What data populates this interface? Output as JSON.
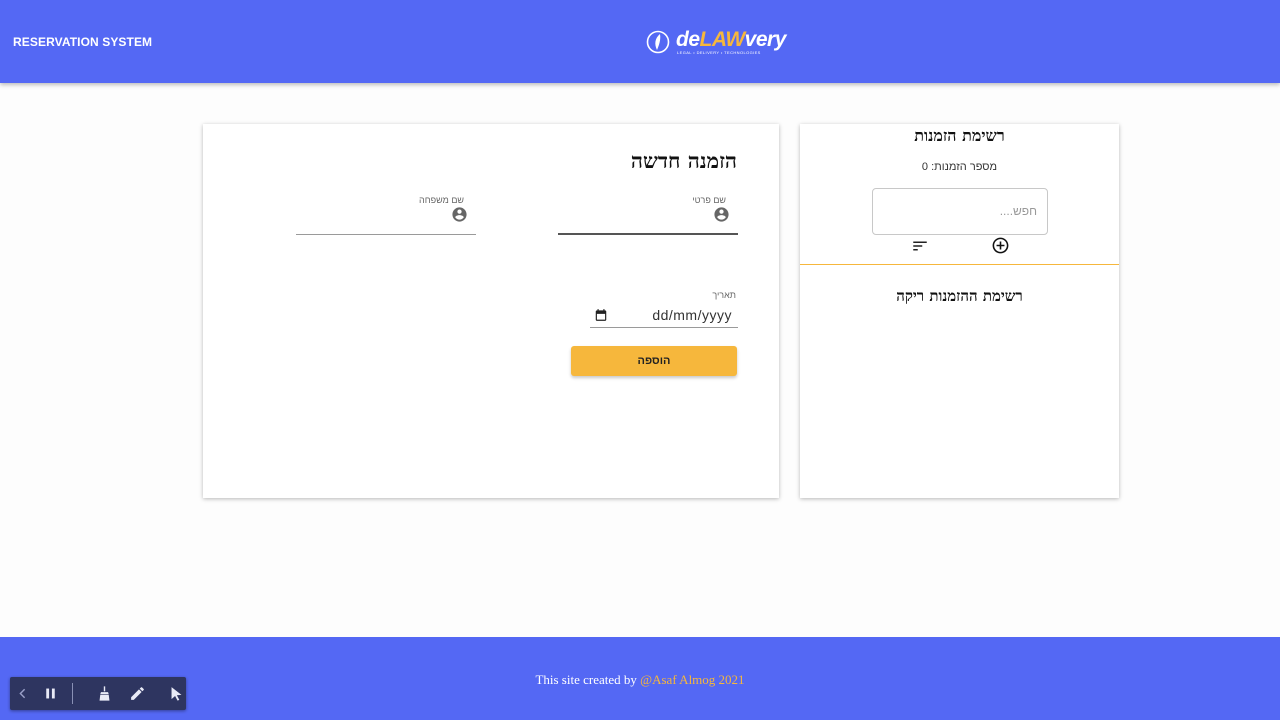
{
  "header": {
    "title": "RESERVATION SYSTEM",
    "logo_prefix": "de",
    "logo_highlight": "LAW",
    "logo_suffix": "very",
    "logo_tagline": "LEGAL • DELIVERY • TECHNOLOGIES"
  },
  "form": {
    "title": "הזמנה חדשה",
    "first_name_label": "שם פרטי",
    "last_name_label": "שם משפחה",
    "date_label": "תאריך",
    "date_placeholder": "dd/mm/yyyy",
    "add_button": "הוספה"
  },
  "list": {
    "title": "רשימת הזמנות",
    "count_text": "מספר הזמנות: 0",
    "search_placeholder": "חפש....",
    "empty_message": "רשימת ההזמנות ריקה"
  },
  "footer": {
    "text": "This site created by",
    "author": "@Asaf Almog 2021"
  },
  "icons": {
    "field": "account-circle-icon",
    "date": "calendar-icon",
    "sort": "sort-icon",
    "add": "add-circle-icon"
  },
  "colors": {
    "primary": "#5468f4",
    "accent": "#f6b73c"
  }
}
